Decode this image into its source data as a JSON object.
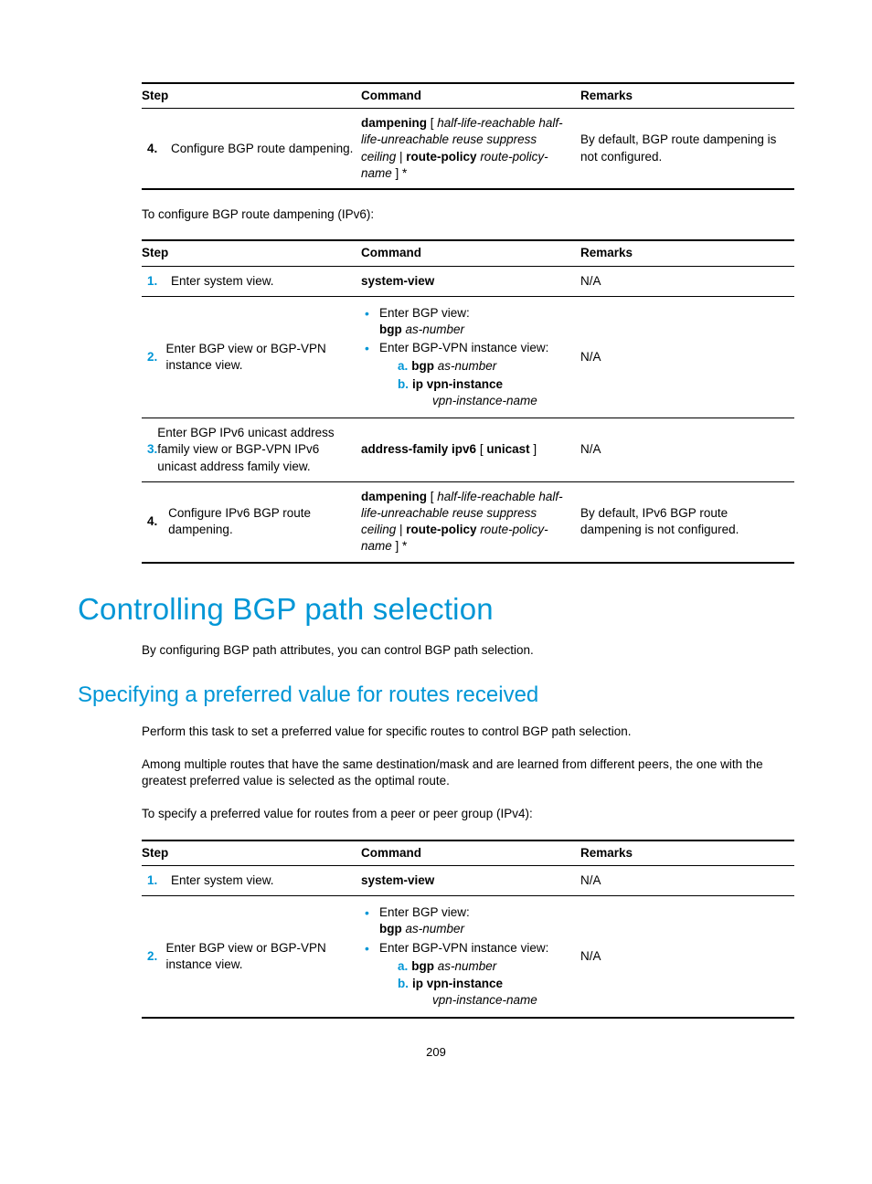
{
  "table1": {
    "headers": {
      "step": "Step",
      "command": "Command",
      "remarks": "Remarks"
    },
    "row4": {
      "num": "4.",
      "desc": "Configure BGP route dampening.",
      "cmd_b1": "dampening",
      "cmd_p1": " [ ",
      "cmd_i1": "half-life-reachable half-life-unreachable reuse suppress ceiling",
      "cmd_p2": " | ",
      "cmd_b2": "route-policy",
      "cmd_i2": " route-policy-name",
      "cmd_p3": " ] *",
      "remarks": "By default, BGP route dampening is not configured."
    }
  },
  "intro1": "To configure BGP route dampening (IPv6):",
  "table2": {
    "headers": {
      "step": "Step",
      "command": "Command",
      "remarks": "Remarks"
    },
    "r1": {
      "num": "1.",
      "desc": "Enter system view.",
      "cmd_b": "system-view",
      "remarks": "N/A"
    },
    "r2": {
      "num": "2.",
      "desc": "Enter BGP view or BGP-VPN instance view.",
      "li1": "Enter BGP view:",
      "li1_b": "bgp",
      "li1_i": " as-number",
      "li2": "Enter BGP-VPN instance view:",
      "a_b": "bgp",
      "a_i": " as-number",
      "b_b": "ip vpn-instance",
      "b_i": "vpn-instance-name",
      "remarks": "N/A"
    },
    "r3": {
      "num": "3.",
      "desc": "Enter BGP IPv6 unicast address family view or BGP-VPN IPv6 unicast address family view.",
      "cmd_b": "address-family ipv6",
      "cmd_p": " [ ",
      "cmd_b2": "unicast",
      "cmd_p2": " ]",
      "remarks": "N/A"
    },
    "r4": {
      "num": "4.",
      "desc": "Configure IPv6 BGP route dampening.",
      "cmd_b1": "dampening",
      "cmd_p1": " [ ",
      "cmd_i1": "half-life-reachable half-life-unreachable reuse suppress ceiling",
      "cmd_p2": " | ",
      "cmd_b2": "route-policy",
      "cmd_i2": " route-policy-name",
      "cmd_p3": " ] *",
      "remarks": "By default, IPv6 BGP route dampening is not configured."
    }
  },
  "h1": "Controlling BGP path selection",
  "p1": "By configuring BGP path attributes, you can control BGP path selection.",
  "h2": "Specifying a preferred value for routes received",
  "p2": "Perform this task to set a preferred value for specific routes to control BGP path selection.",
  "p3": "Among multiple routes that have the same destination/mask and are learned from different peers, the one with the greatest preferred value is selected as the optimal route.",
  "p4": "To specify a preferred value for routes from a peer or peer group (IPv4):",
  "table3": {
    "headers": {
      "step": "Step",
      "command": "Command",
      "remarks": "Remarks"
    },
    "r1": {
      "num": "1.",
      "desc": "Enter system view.",
      "cmd_b": "system-view",
      "remarks": "N/A"
    },
    "r2": {
      "num": "2.",
      "desc": "Enter BGP view or BGP-VPN instance view.",
      "li1": "Enter BGP view:",
      "li1_b": "bgp",
      "li1_i": " as-number",
      "li2": "Enter BGP-VPN instance view:",
      "a_b": "bgp",
      "a_i": " as-number",
      "b_b": "ip vpn-instance",
      "b_i": "vpn-instance-name",
      "remarks": "N/A"
    }
  },
  "pagenum": "209"
}
